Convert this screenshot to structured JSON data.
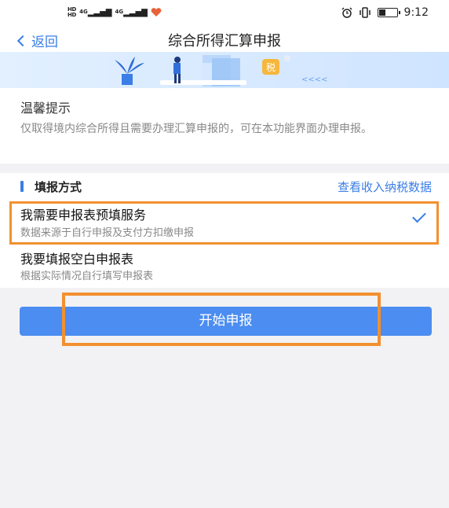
{
  "status_bar": {
    "hd_top": "HD",
    "hd_bottom": "HD",
    "net1": "4G",
    "net2": "4G",
    "time": "9:12",
    "icons": [
      "hd-icon",
      "signal-icon",
      "heart-icon",
      "alarm-icon",
      "vibrate-icon",
      "battery-icon"
    ]
  },
  "navbar": {
    "back_label": "返回",
    "title": "综合所得汇算申报"
  },
  "banner": {
    "tax_badge": "税",
    "arrows": "<<<<"
  },
  "tips": {
    "title": "温馨提示",
    "text": "仅取得境内综合所得且需要办理汇算申报的，可在本功能界面办理申报。"
  },
  "method": {
    "section_title": "填报方式",
    "link_label": "查看收入纳税数据",
    "options": [
      {
        "title": "我需要申报表预填服务",
        "subtitle": "数据来源于自行申报及支付方扣缴申报",
        "selected": true
      },
      {
        "title": "我要填报空白申报表",
        "subtitle": "根据实际情况自行填写申报表",
        "selected": false
      }
    ]
  },
  "start_button": {
    "label": "开始申报"
  },
  "colors": {
    "accent": "#3a7ee6",
    "button": "#4b8df0",
    "highlight": "#f29030",
    "background": "#f2f2f4"
  }
}
